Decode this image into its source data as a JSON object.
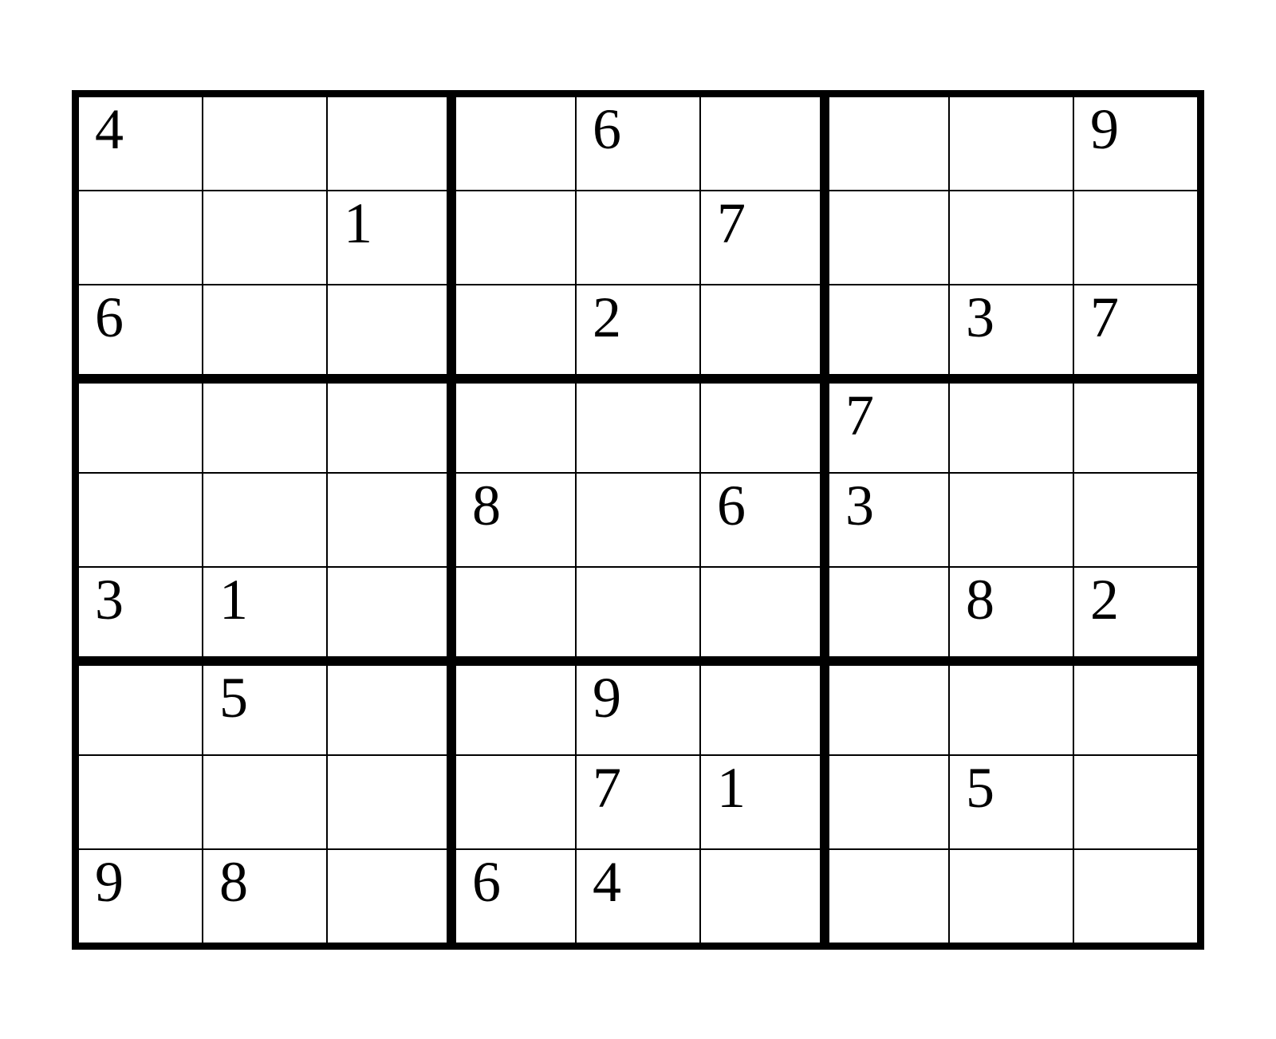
{
  "sudoku": {
    "grid": [
      [
        "4",
        "",
        "",
        "",
        "6",
        "",
        "",
        "",
        "9"
      ],
      [
        "",
        "",
        "1",
        "",
        "",
        "7",
        "",
        "",
        ""
      ],
      [
        "6",
        "",
        "",
        "",
        "2",
        "",
        "",
        "3",
        "7"
      ],
      [
        "",
        "",
        "",
        "",
        "",
        "",
        "7",
        "",
        ""
      ],
      [
        "",
        "",
        "",
        "8",
        "",
        "6",
        "3",
        "",
        ""
      ],
      [
        "3",
        "1",
        "",
        "",
        "",
        "",
        "",
        "8",
        "2"
      ],
      [
        "",
        "5",
        "",
        "",
        "9",
        "",
        "",
        "",
        ""
      ],
      [
        "",
        "",
        "",
        "",
        "7",
        "1",
        "",
        "5",
        ""
      ],
      [
        "9",
        "8",
        "",
        "6",
        "4",
        "",
        "",
        "",
        ""
      ]
    ]
  }
}
